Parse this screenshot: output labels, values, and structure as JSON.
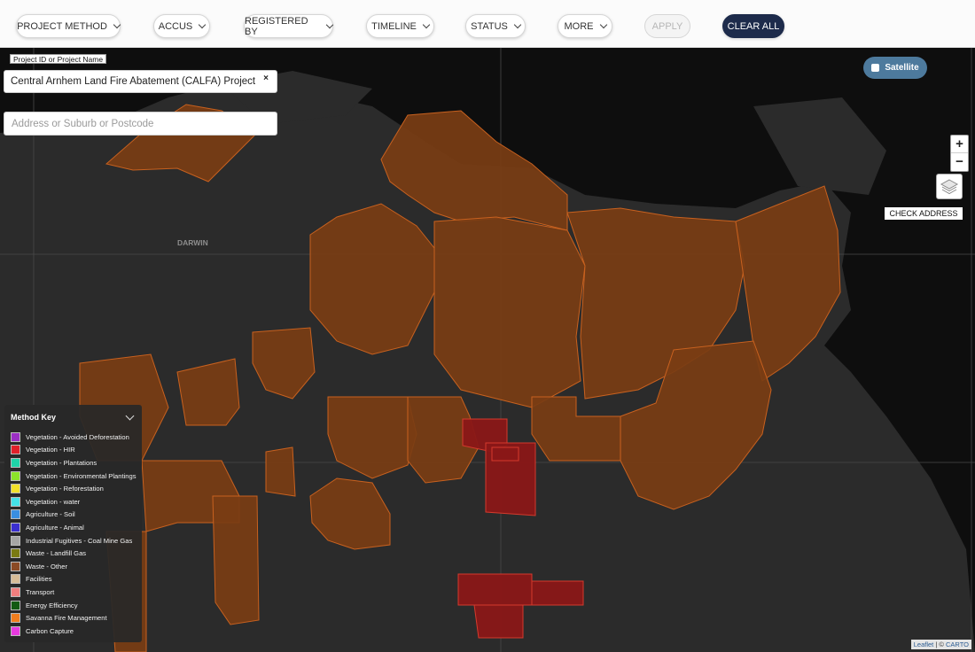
{
  "filters": {
    "project_method": "PROJECT METHOD",
    "accus": "ACCUS",
    "registered_by": "REGISTERED BY",
    "timeline": "TIMELINE",
    "status": "STATUS",
    "more": "MORE",
    "apply": "APPLY",
    "clear_all": "CLEAR ALL"
  },
  "search": {
    "label": "Project ID or Project Name",
    "value": "Central Arnhem Land Fire Abatement (CALFA) Project",
    "clear": "×",
    "address_placeholder": "Address or Suburb or Postcode"
  },
  "map": {
    "satellite_label": "Satellite",
    "zoom_in": "+",
    "zoom_out": "−",
    "check_address": "CHECK ADDRESS",
    "place_label": "DARWIN",
    "attribution": {
      "leaflet": "Leaflet",
      "separator": " | © ",
      "carto": "CARTO"
    },
    "colors": {
      "background": "#0e0e0e",
      "land": "#2b2b2b",
      "savanna": "#e8782e",
      "hir": "#e0202a"
    }
  },
  "legend": {
    "title": "Method Key",
    "items": [
      {
        "label": "Vegetation - Avoided Deforestation",
        "color": "#9b2fc4"
      },
      {
        "label": "Vegetation - HIR",
        "color": "#e0202a"
      },
      {
        "label": "Vegetation - Plantations",
        "color": "#1ed4a8"
      },
      {
        "label": "Vegetation - Environmental Plantings",
        "color": "#8ce32a"
      },
      {
        "label": "Vegetation - Reforestation",
        "color": "#f2e12a"
      },
      {
        "label": "Vegetation - water",
        "color": "#44e2e8"
      },
      {
        "label": "Agriculture - Soil",
        "color": "#3a8ee0"
      },
      {
        "label": "Agriculture - Animal",
        "color": "#3a2fcf"
      },
      {
        "label": "Industrial Fugitives - Coal Mine Gas",
        "color": "#a5a5a5"
      },
      {
        "label": "Waste - Landfill Gas",
        "color": "#7a7a12"
      },
      {
        "label": "Waste - Other",
        "color": "#8b4a24"
      },
      {
        "label": "Facilities",
        "color": "#d6bc97"
      },
      {
        "label": "Transport",
        "color": "#f07e7e"
      },
      {
        "label": "Energy Efficiency",
        "color": "#125a12"
      },
      {
        "label": "Savanna Fire Management",
        "color": "#f07d1e"
      },
      {
        "label": "Carbon Capture",
        "color": "#e83ae0"
      }
    ]
  }
}
